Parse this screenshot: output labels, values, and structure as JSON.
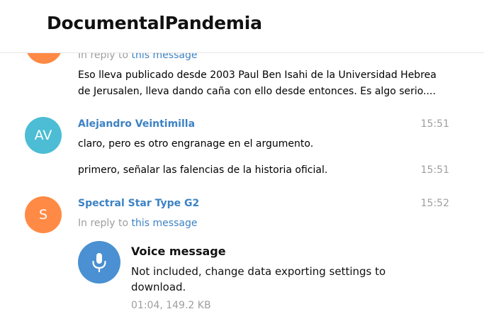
{
  "header": {
    "title": "DocumentalPandemia"
  },
  "messages": [
    {
      "reply_prefix": "In reply to",
      "reply_link": "this message",
      "text_lines": [
        "Eso lleva publicado desde 2003 Paul Ben Isahi de la Universidad Hebrea",
        "de Jerusalen, lleva dando caña con ello desde entonces. Es algo serio...."
      ]
    },
    {
      "initials": "AV",
      "from": "Alejandro Veintimilla",
      "time": "15:51",
      "text": "claro, pero es otro engranage en el argumento."
    },
    {
      "text": "primero, señalar las falencias de la historia oficial.",
      "time": "15:51"
    },
    {
      "initials": "S",
      "from": "Spectral Star Type G2",
      "time": "15:52",
      "reply_prefix": "In reply to",
      "reply_link": "this message",
      "voice": {
        "title": "Voice message",
        "desc": "Not included, change data exporting settings to download.",
        "meta": "01:04, 149.2 KB",
        "icon": "microphone-icon"
      }
    }
  ],
  "colors": {
    "link": "#3c82c4",
    "avatar_orange": "#ff8a45",
    "avatar_cyan": "#4cbdd4",
    "voice_button": "#4a90d2",
    "muted": "#9e9e9e"
  }
}
